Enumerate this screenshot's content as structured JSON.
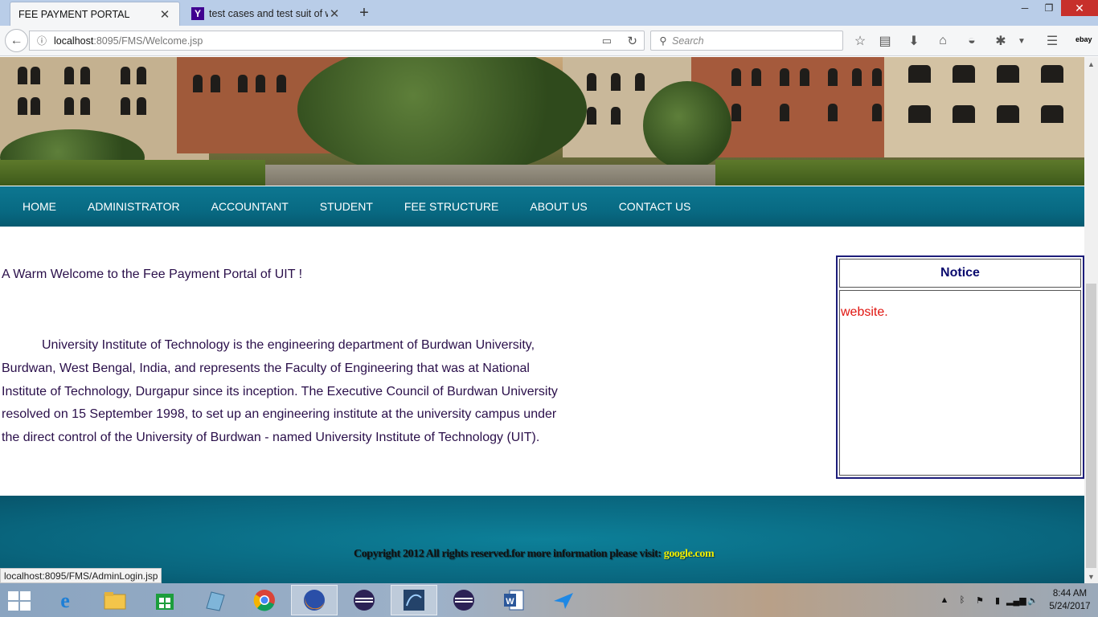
{
  "browser": {
    "tabs": [
      {
        "label": "FEE PAYMENT PORTAL",
        "active": true
      },
      {
        "label": "test cases and test suit of we",
        "active": false,
        "favicon": "Y"
      }
    ],
    "url_host": "localhost",
    "url_path": ":8095/FMS/Welcome.jsp",
    "search_placeholder": "Search",
    "toolbar_extra": "ebay",
    "status_url": "localhost:8095/FMS/AdminLogin.jsp"
  },
  "site": {
    "menu": [
      "HOME",
      "ADMINISTRATOR",
      "ACCOUNTANT",
      "STUDENT",
      "FEE STRUCTURE",
      "ABOUT US",
      "CONTACT US"
    ],
    "welcome": "A Warm Welcome to the Fee Payment Portal of UIT !",
    "intro": "University Institute of Technology is the engineering department of Burdwan University, Burdwan, West Bengal, India, and represents the Faculty of Engineering that was at National Institute of Technology, Durgapur since its inception. The Executive Council of Burdwan University resolved on 15 September 1998, to set up an engineering institute at the university campus under the direct control of the University of Burdwan - named University Institute of Technology (UIT).",
    "notice_title": "Notice",
    "notice_text": "website.",
    "footer_text": "Copyright 2012 All rights reserved.for more information please visit: ",
    "footer_link": "google.com"
  },
  "taskbar": {
    "apps": [
      "internet-explorer",
      "file-explorer",
      "store",
      "notepad",
      "chrome",
      "firefox",
      "eclipse",
      "mysql-workbench",
      "eclipse-2",
      "word",
      "teamviewer"
    ],
    "active_app": "firefox",
    "time": "8:44 AM",
    "date": "5/24/2017"
  },
  "colors": {
    "menu_bg": "#086a83",
    "footer_bg": "#09657d",
    "body_text": "#2a0f4a",
    "notice_text": "#e0140f",
    "notice_title": "#0b0b6e",
    "footer_link": "#f2f000"
  }
}
